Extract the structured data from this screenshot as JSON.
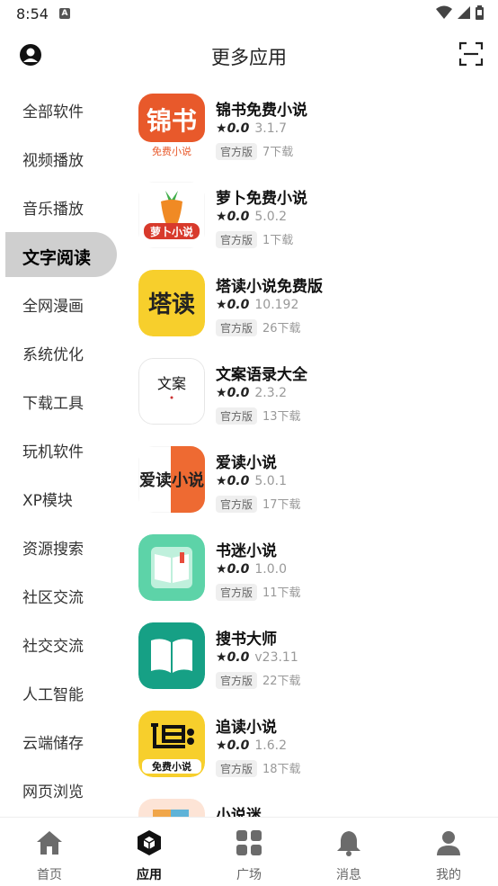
{
  "status": {
    "time": "8:54",
    "notif_icon": "A"
  },
  "header": {
    "title": "更多应用"
  },
  "sidebar": {
    "items": [
      {
        "label": "全部软件"
      },
      {
        "label": "视频播放"
      },
      {
        "label": "音乐播放"
      },
      {
        "label": "文字阅读",
        "active": true
      },
      {
        "label": "全网漫画"
      },
      {
        "label": "系统优化"
      },
      {
        "label": "下载工具"
      },
      {
        "label": "玩机软件"
      },
      {
        "label": "XP模块"
      },
      {
        "label": "资源搜索"
      },
      {
        "label": "社区交流"
      },
      {
        "label": "社交交流"
      },
      {
        "label": "人工智能"
      },
      {
        "label": "云端储存"
      },
      {
        "label": "网页浏览"
      }
    ]
  },
  "apps": [
    {
      "name": "锦书免费小说",
      "rating": "0.0",
      "version": "3.1.7",
      "badge": "官方版",
      "downloads": "7下载",
      "icon": "jinshu-icon",
      "icon_text": "锦书",
      "icon_sub": "免费小说"
    },
    {
      "name": "萝卜免费小说",
      "rating": "0.0",
      "version": "5.0.2",
      "badge": "官方版",
      "downloads": "1下载",
      "icon": "carrot-icon",
      "icon_text": "萝卜小说"
    },
    {
      "name": "塔读小说免费版",
      "rating": "0.0",
      "version": "10.192",
      "badge": "官方版",
      "downloads": "26下载",
      "icon": "tadu-icon",
      "icon_text": "塔读"
    },
    {
      "name": "文案语录大全",
      "rating": "0.0",
      "version": "2.3.2",
      "badge": "官方版",
      "downloads": "13下载",
      "icon": "wenan-icon",
      "icon_text": "文案"
    },
    {
      "name": "爱读小说",
      "rating": "0.0",
      "version": "5.0.1",
      "badge": "官方版",
      "downloads": "17下载",
      "icon": "aidu-icon",
      "icon_text": "爱读小说"
    },
    {
      "name": "书迷小说",
      "rating": "0.0",
      "version": "1.0.0",
      "badge": "官方版",
      "downloads": "11下载",
      "icon": "book-green-icon"
    },
    {
      "name": "搜书大师",
      "rating": "0.0",
      "version": "v23.11",
      "badge": "官方版",
      "downloads": "22下载",
      "icon": "book-teal-icon"
    },
    {
      "name": "追读小说",
      "rating": "0.0",
      "version": "1.6.2",
      "badge": "官方版",
      "downloads": "18下载",
      "icon": "zhuidu-icon",
      "icon_sub": "免费小说"
    },
    {
      "name": "小说迷",
      "rating": "",
      "version": "",
      "badge": "",
      "downloads": "",
      "icon": "xiaoshuomi-icon"
    }
  ],
  "tabbar": {
    "tabs": [
      {
        "label": "首页",
        "icon": "home-icon"
      },
      {
        "label": "应用",
        "icon": "apps-cube-icon",
        "active": true
      },
      {
        "label": "广场",
        "icon": "grid-icon"
      },
      {
        "label": "消息",
        "icon": "bell-icon"
      },
      {
        "label": "我的",
        "icon": "person-icon"
      }
    ]
  },
  "colors": {
    "active_bg": "#cfcfcf",
    "accent_orange": "#e8592b",
    "yellow": "#f7cf2c",
    "green": "#5dd3a8",
    "teal": "#16a085"
  }
}
